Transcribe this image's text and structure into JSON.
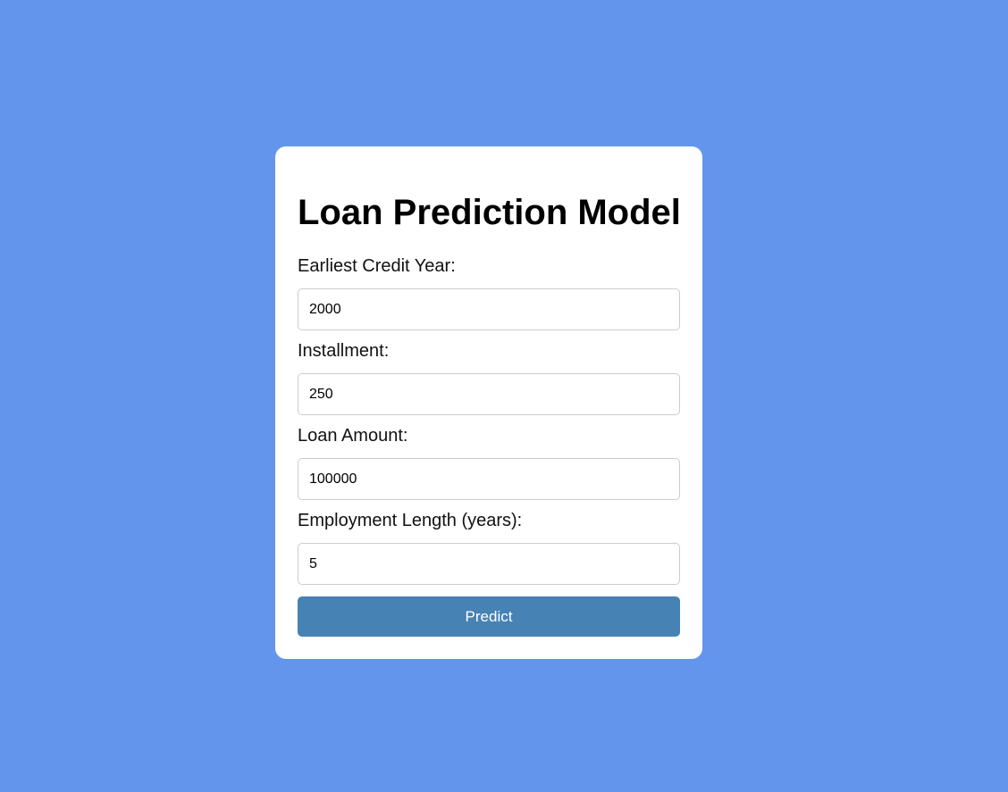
{
  "page": {
    "title": "Loan Prediction Model",
    "background_color": "#6495ED",
    "button_color": "#4682B4"
  },
  "form": {
    "fields": [
      {
        "label": "Earliest Credit Year:",
        "value": "2000"
      },
      {
        "label": "Installment:",
        "value": "250"
      },
      {
        "label": "Loan Amount:",
        "value": "100000"
      },
      {
        "label": "Employment Length (years):",
        "value": "5"
      }
    ],
    "submit_label": "Predict"
  }
}
